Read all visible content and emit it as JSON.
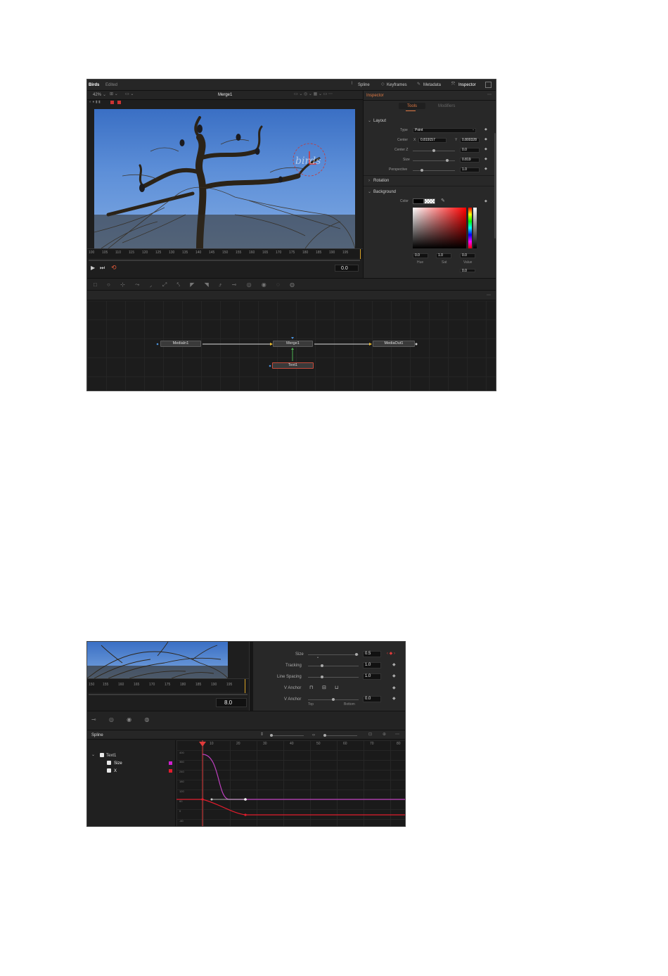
{
  "shot1": {
    "topbar": {
      "project": "Birds",
      "status": "Edited",
      "tabs": [
        "Spline",
        "Keyframes",
        "Metadata",
        "Inspector"
      ]
    },
    "viewer": {
      "zoom": "42%",
      "title": "Merge1",
      "overlay_text": "birds",
      "ruler_ticks": [
        "100",
        "105",
        "110",
        "115",
        "120",
        "125",
        "130",
        "135",
        "140",
        "145",
        "150",
        "155",
        "160",
        "165",
        "170",
        "175",
        "180",
        "185",
        "190",
        "195"
      ],
      "timecode": "0.0"
    },
    "inspector": {
      "title": "Inspector",
      "tabs": [
        "Tools",
        "Modifiers"
      ],
      "layout_section": "Layout",
      "type_label": "Type",
      "type_value": "Point",
      "center_label": "Center",
      "center_x_label": "X",
      "center_x": "0.819157",
      "center_y_label": "Y",
      "center_y": "0.800328",
      "center_z_label": "Center Z",
      "center_z": "0.0",
      "size_label": "Size",
      "size_value": "0.819",
      "perspective_label": "Perspective",
      "perspective_value": "1.0",
      "rotation_section": "Rotation",
      "background_section": "Background",
      "color_label": "Color",
      "hue_value": "0.0",
      "sat_value": "1.0",
      "value_value": "0.0",
      "hue_label": "Hue",
      "sat_label": "Sat",
      "val_label": "Value",
      "bottom_value": "0.0"
    },
    "nodes": {
      "media_in": "MediaIn1",
      "merge": "Merge1",
      "media_out": "MediaOut1",
      "text": "Text1"
    }
  },
  "shot2": {
    "ruler_ticks": [
      "150",
      "155",
      "160",
      "165",
      "170",
      "175",
      "180",
      "185",
      "190",
      "195"
    ],
    "timecode": "8.0",
    "props": {
      "size_label": "Size",
      "size_value": "0.5",
      "tracking_label": "Tracking",
      "tracking_value": "1.0",
      "line_spacing_label": "Line Spacing",
      "line_spacing_value": "1.0",
      "v_anchor_label": "V Anchor",
      "v_anchor2_label": "V Anchor",
      "v_anchor_value": "0.0",
      "top_label": "Top",
      "bottom_label": "Bottom"
    },
    "spline": {
      "title": "Spline",
      "tree_root": "Text1",
      "tree_size": "Size",
      "tree_x": "X",
      "frame_ticks": [
        "10",
        "20",
        "30",
        "40",
        "50",
        "60",
        "70",
        "80"
      ],
      "value_ticks": [
        "400",
        "360",
        "240",
        "180",
        "120",
        "60",
        "0",
        "-60"
      ],
      "colors": {
        "size_curve": "#c040c0",
        "x_curve": "#e03040",
        "playhead": "#e03a3a"
      }
    }
  }
}
